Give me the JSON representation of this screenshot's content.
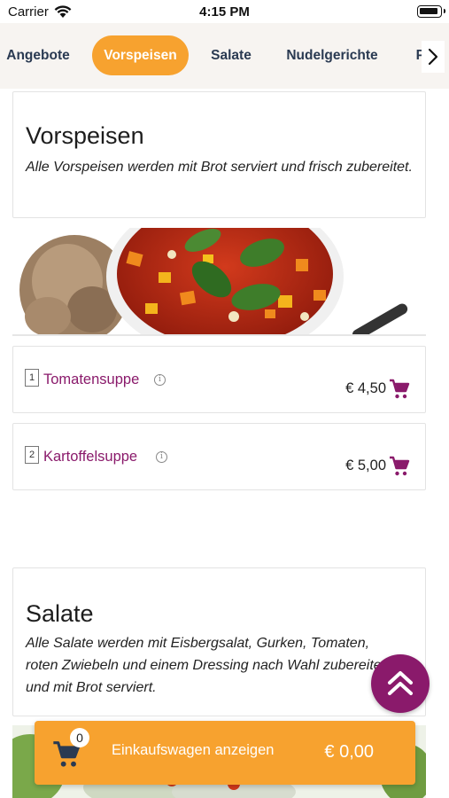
{
  "status": {
    "carrier": "Carrier",
    "time": "4:15 PM"
  },
  "categories": [
    {
      "label": "Angebote",
      "active": false
    },
    {
      "label": "Vorspeisen",
      "active": true
    },
    {
      "label": "Salate",
      "active": false
    },
    {
      "label": "Nudelgerichte",
      "active": false
    },
    {
      "label": "Pi",
      "active": false
    }
  ],
  "sections": [
    {
      "title": "Vorspeisen",
      "description": "Alle Vorspeisen werden mit Brot serviert und frisch zubereitet.",
      "items": [
        {
          "number": "1",
          "name": "Tomatensuppe",
          "price": "€ 4,50"
        },
        {
          "number": "2",
          "name": "Kartoffelsuppe",
          "price": "€ 5,00"
        }
      ]
    },
    {
      "title": "Salate",
      "description": "Alle Salate werden mit Eisbergsalat, Gurken, Tomaten, roten Zwiebeln und einem Dressing nach Wahl zubereitet und mit Brot serviert."
    }
  ],
  "basket": {
    "count": "0",
    "label": "Einkaufswagen anzeigen",
    "total": "€ 0,00"
  },
  "colors": {
    "accent": "#f7a22f",
    "brand": "#8a1a6b",
    "tabBar": "#f7f4f1"
  },
  "icons": [
    "wifi-icon",
    "battery-icon",
    "chevron-right-icon",
    "info-icon",
    "cart-icon",
    "double-chevron-up-icon"
  ]
}
